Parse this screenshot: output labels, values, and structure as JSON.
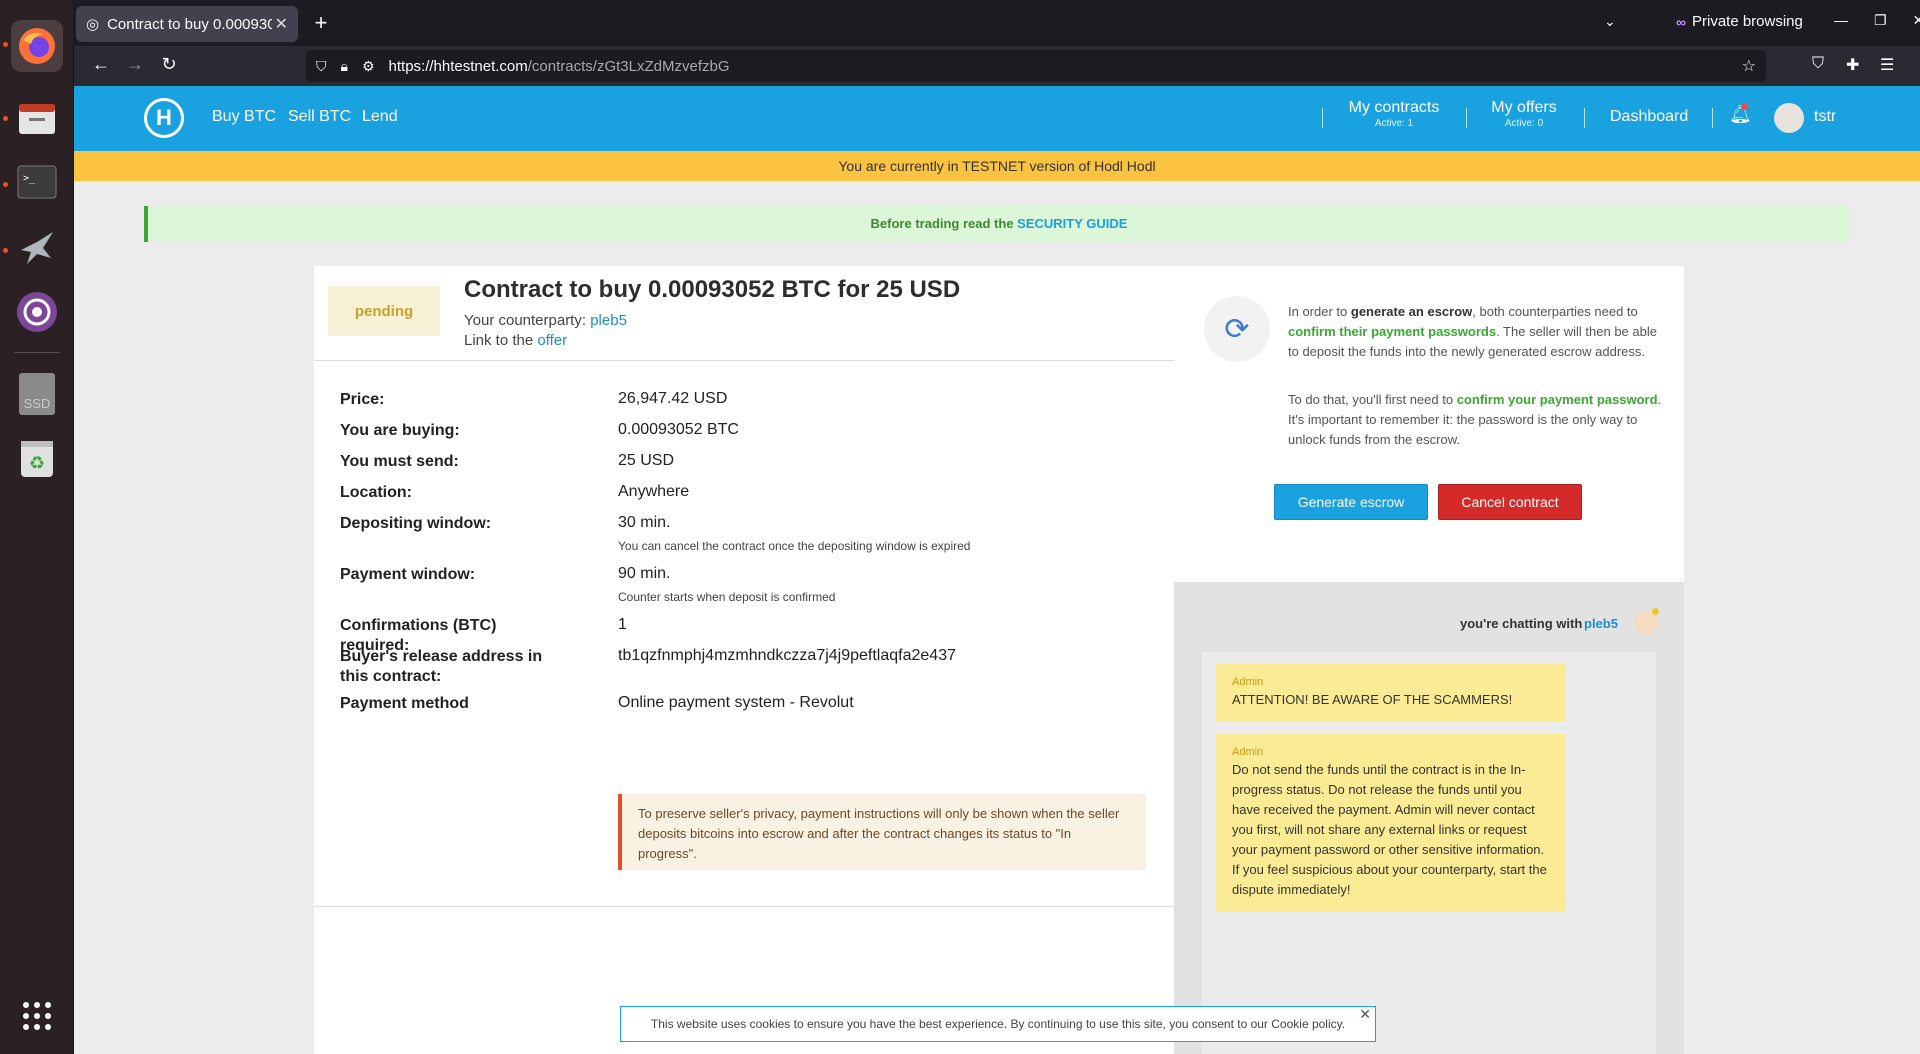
{
  "browser": {
    "tab_title": "Contract to buy 0.00093052 BTC for 25 USD",
    "url_host": "https://hhtestnet.com",
    "url_path": "/contracts/zGt3LxZdMzvefzbG",
    "private_label": "Private browsing"
  },
  "dock": {
    "items": [
      "firefox-icon",
      "files-icon",
      "terminal-icon",
      "bird-icon",
      "tor-icon",
      "ssd-icon",
      "trash-icon",
      "apps-grid-icon"
    ],
    "ssd_label": "SSD"
  },
  "header": {
    "nav": [
      "Buy BTC",
      "Sell BTC",
      "Lend"
    ],
    "my_contracts": "My contracts",
    "my_contracts_sub": "Active: 1",
    "my_offers": "My offers",
    "my_offers_sub": "Active: 0",
    "dashboard": "Dashboard",
    "username": "tstr"
  },
  "testnet_banner": "You are currently in TESTNET version of Hodl Hodl",
  "security": {
    "prefix": "Before trading read the ",
    "link": "SECURITY GUIDE"
  },
  "contract": {
    "status": "pending",
    "title": "Contract to buy 0.00093052 BTC for 25 USD",
    "counterparty_label": "Your counterparty: ",
    "counterparty": "pleb5",
    "offer_label": "Link to the ",
    "offer_link": "offer",
    "rows": [
      {
        "label": "Price:",
        "value": "26,947.42 USD"
      },
      {
        "label": "You are buying:",
        "value": "0.00093052 BTC"
      },
      {
        "label": "You must send:",
        "value": "25 USD"
      },
      {
        "label": "Location:",
        "value": "Anywhere"
      },
      {
        "label": "Depositing window:",
        "value": "30 min.",
        "note": "You can cancel the contract once the depositing window is expired"
      },
      {
        "label": "Payment window:",
        "value": "90 min.",
        "note": "Counter starts when deposit is confirmed"
      },
      {
        "label": "Confirmations (BTC) required:",
        "value": "1"
      },
      {
        "label": "Buyer's release address in this contract:",
        "value": "tb1qzfnmphj4mzmhndkczza7j4j9peftlaqfa2e437"
      },
      {
        "label": "Payment method",
        "value": "Online payment system - Revolut"
      }
    ],
    "privacy_note": "To preserve seller's privacy, payment instructions will only be shown when the seller deposits bitcoins into escrow and after the contract changes its status to \"In progress\"."
  },
  "escrow": {
    "p1_a": "In order to ",
    "p1_b": "generate an escrow",
    "p1_c": ", both counterparties need to ",
    "p1_d": "confirm their payment passwords",
    "p1_e": ". The seller will then be able to deposit the funds into the newly generated escrow address.",
    "p2_a": "To do that, you'll first need to ",
    "p2_b": "confirm your payment password",
    "p2_c": ". It's important to remember it: the password is the only way to unlock funds from the escrow.",
    "generate_btn": "Generate escrow",
    "cancel_btn": "Cancel contract"
  },
  "chat": {
    "with_label": "you're chatting with",
    "peer": "pleb5",
    "messages": [
      {
        "author": "Admin",
        "text": "ATTENTION! BE AWARE OF THE SCAMMERS!"
      },
      {
        "author": "Admin",
        "text": "Do not send the funds until the contract is in the In-progress status. Do not release the funds until you have received the payment. Admin will never contact you first, will not share any external links or request your payment password or other sensitive information. If you feel suspicious about your counterparty, start the dispute immediately!"
      }
    ]
  },
  "cookie_notice": "This website uses cookies to ensure you have the best experience. By continuing to use this site, you consent to our Cookie policy."
}
